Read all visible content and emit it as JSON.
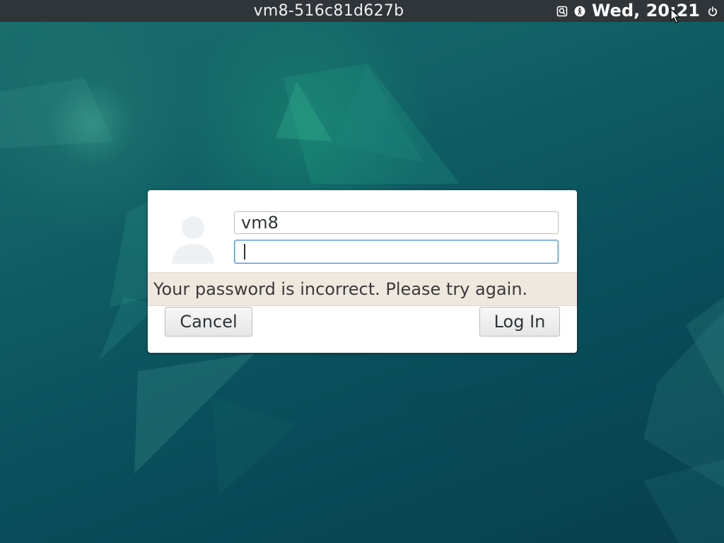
{
  "topbar": {
    "hostname": "vm8-516c81d627b",
    "clock": "Wed, 20:21",
    "icons": [
      "keyboard-layout-icon",
      "accessibility-icon",
      "power-icon"
    ]
  },
  "login": {
    "username": "vm8",
    "password": "",
    "error_message": "Your password is incorrect. Please try again.",
    "cancel_label": "Cancel",
    "login_label": "Log In",
    "avatar_icon": "user-avatar-icon"
  },
  "colors": {
    "topbar_bg": "#30353a",
    "focus_border": "#4a90d9",
    "error_bg": "#efe8df",
    "desktop_teal": "#0b4f58"
  }
}
